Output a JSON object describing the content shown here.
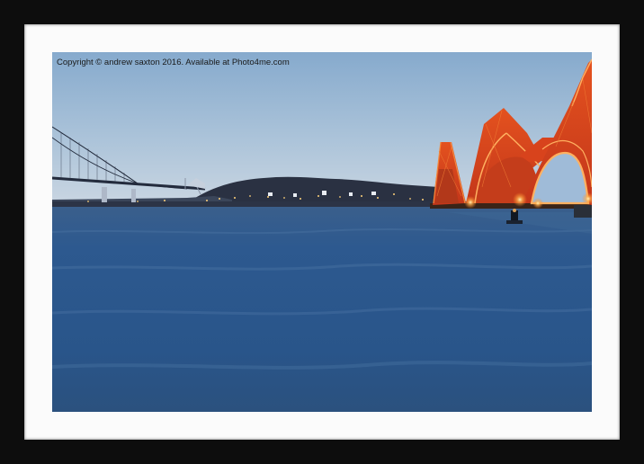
{
  "watermark": {
    "text": "Copyright  © andrew saxton  2016. Available at Photo4me.com"
  },
  "colors": {
    "frame": "#0d0d0d",
    "mount": "#fbfbfb",
    "sky_top": "#8fb3d4",
    "sky_bottom": "#c5d3e0",
    "water": "#2f5a8c",
    "bridge_red": "#d8431c",
    "bridge_glow": "#ffae4a"
  },
  "scene": {
    "subjects": [
      "forth-rail-bridge",
      "forth-road-bridge",
      "firth-of-forth-water",
      "far-shore-town"
    ]
  }
}
